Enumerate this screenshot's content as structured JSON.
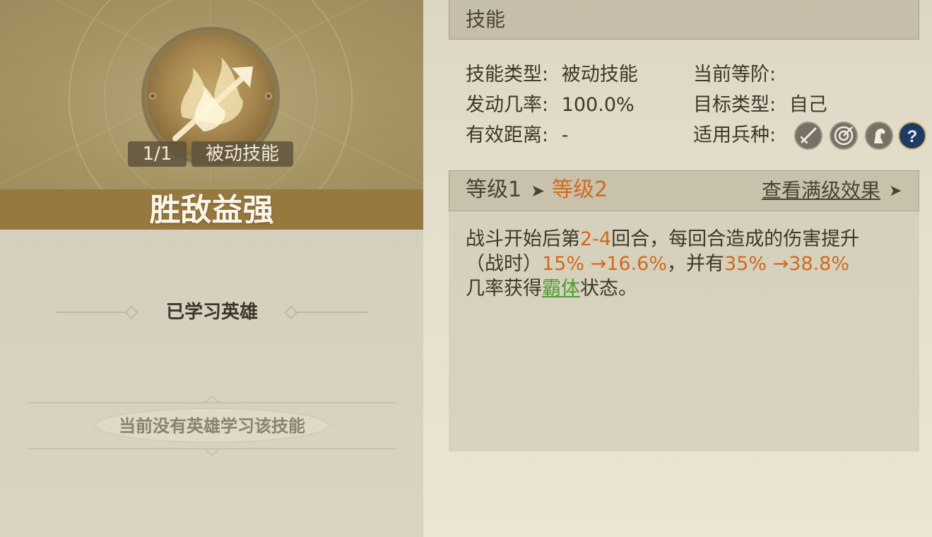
{
  "skill": {
    "count_badge": "1/1",
    "type_badge": "被动技能",
    "name": "胜敌益强"
  },
  "learned_section": {
    "title": "已学习英雄",
    "empty_text": "当前没有英雄学习该技能"
  },
  "header": {
    "title": "技能"
  },
  "attributes": {
    "skill_type": {
      "label": "技能类型:",
      "value": "被动技能"
    },
    "current_rank": {
      "label": "当前等阶:",
      "value": ""
    },
    "trigger_rate": {
      "label": "发动几率:",
      "value": "100.0%"
    },
    "target_type": {
      "label": "目标类型:",
      "value": "自己"
    },
    "effective_range": {
      "label": "有效距离:",
      "value": "-"
    },
    "troop_types": {
      "label": "适用兵种:",
      "icons": [
        "sword-icon",
        "target-icon",
        "horse-icon",
        "help-icon"
      ]
    }
  },
  "level": {
    "from": "等级1",
    "arrow": "➤",
    "to": "等级2",
    "view_max": "查看满级效果",
    "view_max_arrow": "➤"
  },
  "description": {
    "line1": {
      "a": "战斗开始后第",
      "b": "2-4",
      "c": "回合，每回合造成的伤害提升"
    },
    "line2": {
      "a": "（战时）",
      "b": "15% →16.6%",
      "c": "，并有",
      "d": "35% →38.8%"
    },
    "line3": {
      "a": "几率获得",
      "b": "霸体",
      "c": "状态。"
    }
  },
  "colors": {
    "highlight_orange": "#d06a1f",
    "highlight_green": "#4f9b36",
    "name_bar": "#97783f"
  }
}
